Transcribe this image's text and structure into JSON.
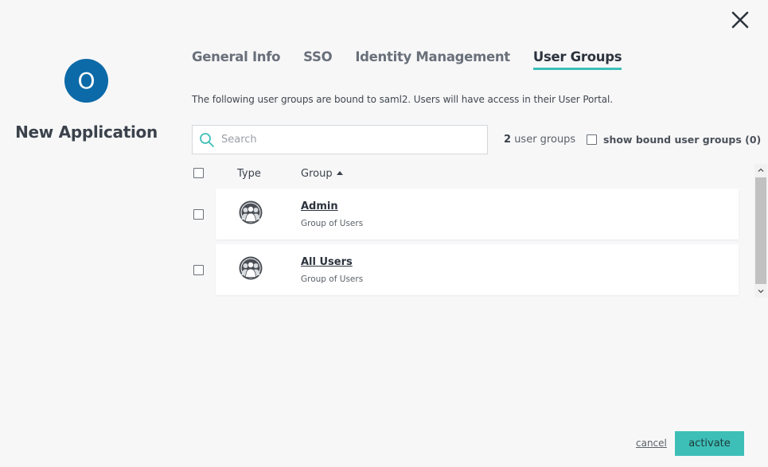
{
  "dialog": {
    "close_icon": "close-icon"
  },
  "app": {
    "avatar_letter": "O",
    "avatar_color": "#0c6aa8",
    "title": "New Application"
  },
  "tabs": [
    {
      "label": "General Info",
      "active": false
    },
    {
      "label": "SSO",
      "active": false
    },
    {
      "label": "Identity Management",
      "active": false
    },
    {
      "label": "User Groups",
      "active": true
    }
  ],
  "accent_color": "#3dbfb7",
  "description": "The following user groups are bound to saml2. Users will have access in their User Portal.",
  "search": {
    "placeholder": "Search",
    "value": ""
  },
  "group_count": {
    "number": "2",
    "label": "user groups"
  },
  "show_bound": {
    "label": "show bound user groups (0)",
    "checked": false
  },
  "table": {
    "columns": {
      "type": "Type",
      "group": "Group"
    },
    "sort": "ascending",
    "rows": [
      {
        "name": "Admin",
        "subtitle": "Group of Users",
        "icon": "user-group-icon"
      },
      {
        "name": "All Users",
        "subtitle": "Group of Users",
        "icon": "user-group-icon"
      }
    ]
  },
  "footer": {
    "cancel_label": "cancel",
    "activate_label": "activate"
  }
}
